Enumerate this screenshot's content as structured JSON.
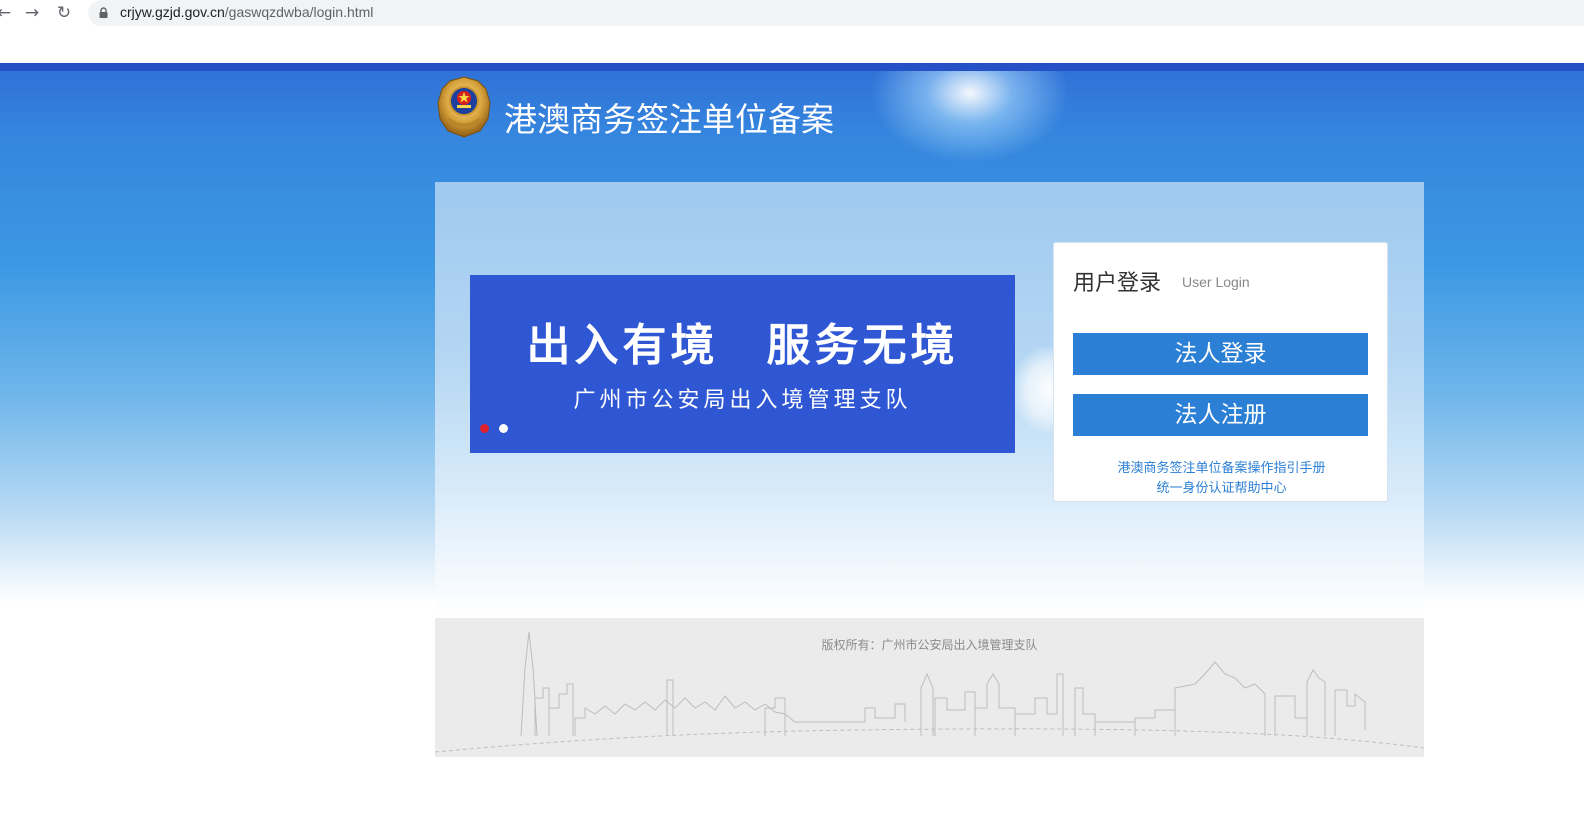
{
  "browser": {
    "back_icon": "arrow-left-icon",
    "forward_icon": "arrow-right-icon",
    "reload_icon": "reload-icon",
    "lock_icon": "lock-icon",
    "url_domain": "crjyw.gzjd.gov.cn",
    "url_path": "/gaswqzdwba/login.html"
  },
  "header": {
    "emblem_icon": "police-emblem-icon",
    "title": "港澳商务签注单位备案"
  },
  "banner": {
    "title": "出入有境　服务无境",
    "subtitle": "广州市公安局出入境管理支队",
    "slide_count": 2,
    "active_slide": 1
  },
  "login": {
    "title": "用户登录",
    "subtitle": "User Login",
    "login_button": "法人登录",
    "register_button": "法人注册",
    "help_links": [
      "港澳商务签注单位备案操作指引手册",
      "统一身份认证帮助中心"
    ]
  },
  "footer": {
    "copyright": "版权所有：广州市公安局出入境管理支队"
  },
  "colors": {
    "topbar": "#2550c6",
    "banner": "#2f57d4",
    "button": "#2b7fd4",
    "link": "#2b7fd4"
  }
}
